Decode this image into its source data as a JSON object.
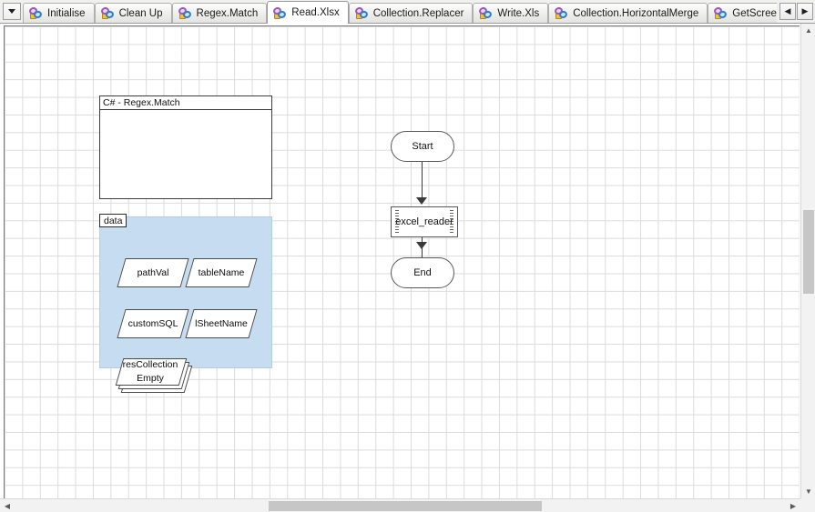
{
  "window": {
    "title": "Read.Xlsx"
  },
  "tabstrip": {
    "dropdown_icon": "chevron-down-icon",
    "scroll_left_glyph": "◀",
    "scroll_right_glyph": "▶",
    "tab_icon": "object-rings-icon",
    "active_index": 3,
    "tabs": [
      {
        "label": "Initialise"
      },
      {
        "label": "Clean Up"
      },
      {
        "label": "Regex.Match"
      },
      {
        "label": "Read.Xlsx"
      },
      {
        "label": "Collection.Replacer"
      },
      {
        "label": "Write.Xls"
      },
      {
        "label": "Collection.HorizontalMerge"
      },
      {
        "label": "GetScreenshot"
      }
    ]
  },
  "canvas": {
    "code_block": {
      "title": "C# - Regex.Match",
      "body": ""
    },
    "data_container": {
      "label": "data",
      "fill_color": "#c6dcf0",
      "items": [
        {
          "label": "pathVal",
          "shape": "parallelogram"
        },
        {
          "label": "tableName",
          "shape": "parallelogram"
        },
        {
          "label": "customSQL",
          "shape": "parallelogram"
        },
        {
          "label": "lSheetName",
          "shape": "parallelogram"
        }
      ],
      "collection": {
        "name": "resCollection",
        "state": "Empty",
        "shape": "stacked-parallelogram"
      }
    },
    "flow": {
      "start": {
        "label": "Start",
        "shape": "terminator"
      },
      "subprocess": {
        "label": "excel_reader",
        "shape": "subprocess"
      },
      "end": {
        "label": "End",
        "shape": "terminator"
      }
    }
  },
  "scrollbars": {
    "vertical": {
      "up_glyph": "▲",
      "down_glyph": "▼"
    },
    "horizontal": {
      "left_glyph": "◀",
      "right_glyph": "▶"
    }
  }
}
